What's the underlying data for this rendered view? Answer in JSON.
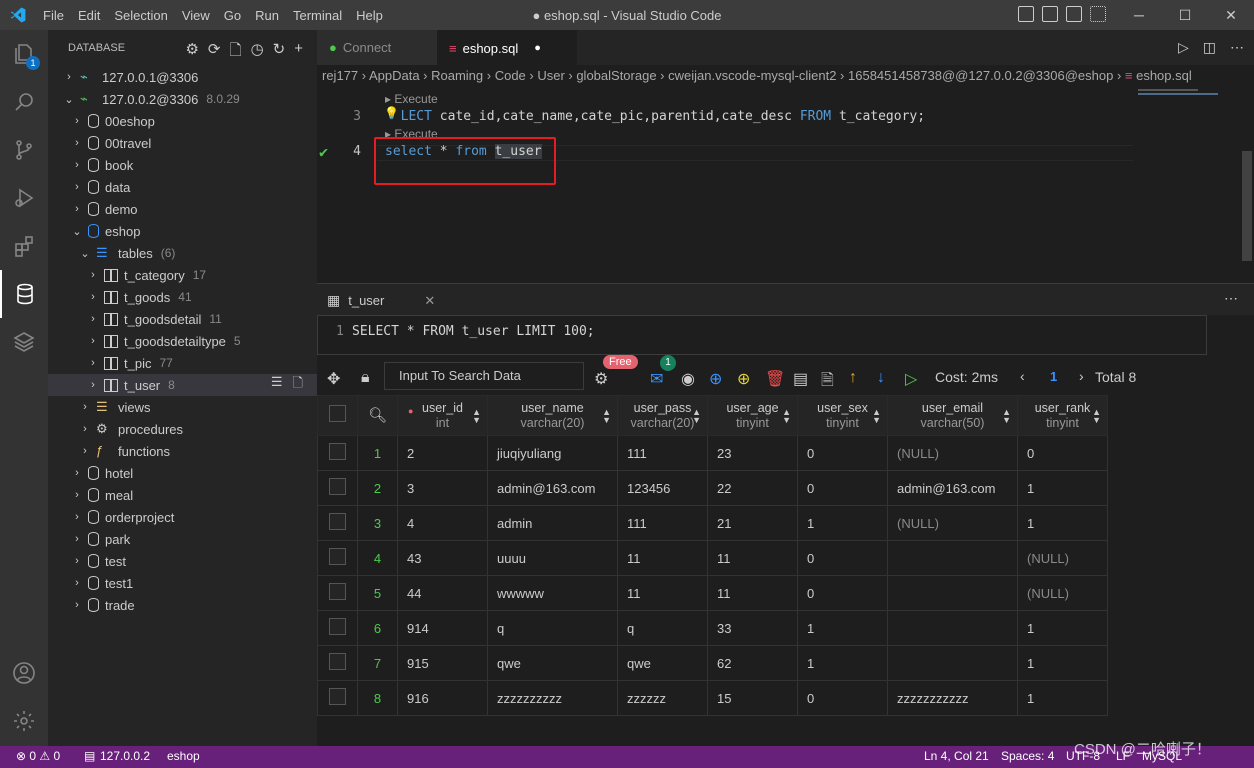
{
  "app": {
    "title": "● eshop.sql - Visual Studio Code",
    "menu": [
      "File",
      "Edit",
      "Selection",
      "View",
      "Go",
      "Run",
      "Terminal",
      "Help"
    ]
  },
  "activity": {
    "explorer_badge": "1"
  },
  "sidebar": {
    "header": "DATABASE",
    "connections": [
      {
        "label": "127.0.0.1@3306",
        "version": ""
      },
      {
        "label": "127.0.0.2@3306",
        "version": "8.0.29"
      }
    ],
    "databases": [
      "00eshop",
      "00travel",
      "book",
      "data",
      "demo",
      "eshop"
    ],
    "tables_group": {
      "label": "tables",
      "count": "(6)"
    },
    "tables": [
      {
        "name": "t_category",
        "count": "17"
      },
      {
        "name": "t_goods",
        "count": "41"
      },
      {
        "name": "t_goodsdetail",
        "count": "11"
      },
      {
        "name": "t_goodsdetailtype",
        "count": "5"
      },
      {
        "name": "t_pic",
        "count": "77"
      },
      {
        "name": "t_user",
        "count": "8"
      }
    ],
    "groups": [
      "views",
      "procedures",
      "functions"
    ],
    "more_databases": [
      "hotel",
      "meal",
      "orderproject",
      "park",
      "test",
      "test1",
      "trade"
    ]
  },
  "tabs": [
    {
      "label": "Connect"
    },
    {
      "label": "eshop.sql"
    }
  ],
  "breadcrumb": "rej177 › AppData › Roaming › Code › User › globalStorage › cweijan.vscode-mysql-client2 › 1658451458738@@127.0.0.2@3306@eshop › ",
  "breadcrumb_file": "eshop.sql",
  "editor": {
    "lens": "Execute",
    "line3_num": "3",
    "line3_kw1": "LECT",
    "line3_text": " cate_id,cate_name,cate_pic,parentid,cate_desc ",
    "line3_kw2": "FROM",
    "line3_tail": " t_category;",
    "line4_num": "4",
    "line4_kw1": "select",
    "line4_mid": " * ",
    "line4_kw2": "from",
    "line4_sp": " ",
    "line4_tbl": "t_user"
  },
  "panel": {
    "tab": "t_user",
    "query": "SELECT * FROM t_user LIMIT 100;",
    "search_placeholder": "Input To Search Data",
    "free_badge": "Free",
    "mail_badge": "1",
    "cost": "Cost: 2ms",
    "page": "1",
    "total": "Total 8"
  },
  "grid": {
    "columns": [
      {
        "name": "user_id",
        "type": "int",
        "key": true
      },
      {
        "name": "user_name",
        "type": "varchar(20)"
      },
      {
        "name": "user_pass",
        "type": "varchar(20)"
      },
      {
        "name": "user_age",
        "type": "tinyint"
      },
      {
        "name": "user_sex",
        "type": "tinyint"
      },
      {
        "name": "user_email",
        "type": "varchar(50)"
      },
      {
        "name": "user_rank",
        "type": "tinyint"
      }
    ],
    "rows": [
      [
        "1",
        "2",
        "jiuqiyuliang",
        "111",
        "23",
        "0",
        "(NULL)",
        "0"
      ],
      [
        "2",
        "3",
        "admin@163.com",
        "123456",
        "22",
        "0",
        "admin@163.com",
        "1"
      ],
      [
        "3",
        "4",
        "admin",
        "111",
        "21",
        "1",
        "(NULL)",
        "1"
      ],
      [
        "4",
        "43",
        "uuuu",
        "11",
        "11",
        "0",
        "",
        "(NULL)"
      ],
      [
        "5",
        "44",
        "wwwww",
        "11",
        "11",
        "0",
        "",
        "(NULL)"
      ],
      [
        "6",
        "914",
        "q",
        "q",
        "33",
        "1",
        "",
        "1"
      ],
      [
        "7",
        "915",
        "qwe",
        "qwe",
        "62",
        "1",
        "",
        "1"
      ],
      [
        "8",
        "916",
        "zzzzzzzzzz",
        "zzzzzz",
        "15",
        "0",
        "zzzzzzzzzzz",
        "1"
      ]
    ]
  },
  "status": {
    "problems": "⊗ 0 ⚠ 0",
    "connection": "127.0.0.2",
    "db": "eshop",
    "position": "Ln 4, Col 21",
    "spaces": "Spaces: 4",
    "encoding": "UTF-8",
    "eol": "LF",
    "language": "MySQL",
    "watermark": "CSDN @二哈喇子！"
  },
  "colors": {
    "accent": "#007acc",
    "status": "#68217a",
    "highlight": "#e51c23"
  }
}
